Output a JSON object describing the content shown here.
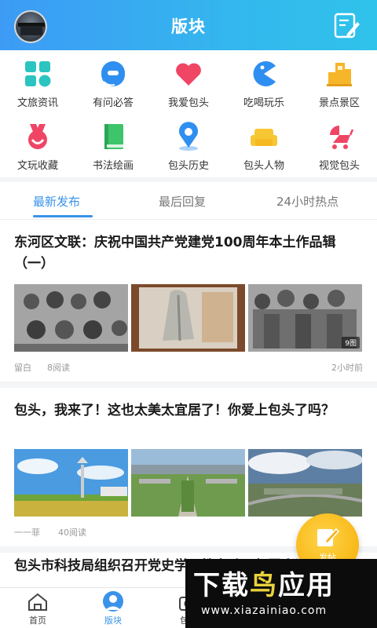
{
  "header": {
    "title": "版块"
  },
  "categories": [
    {
      "label": "文旅资讯",
      "icon": "grid-icon"
    },
    {
      "label": "有问必答",
      "icon": "headset-icon"
    },
    {
      "label": "我爱包头",
      "icon": "heart-icon"
    },
    {
      "label": "吃喝玩乐",
      "icon": "pacman-icon"
    },
    {
      "label": "景点景区",
      "icon": "building-icon"
    },
    {
      "label": "文玩收藏",
      "icon": "medal-icon"
    },
    {
      "label": "书法绘画",
      "icon": "book-icon"
    },
    {
      "label": "包头历史",
      "icon": "location-pin-icon"
    },
    {
      "label": "包头人物",
      "icon": "sofa-icon"
    },
    {
      "label": "视觉包头",
      "icon": "stroller-icon"
    }
  ],
  "tabs": [
    {
      "label": "最新发布",
      "active": true
    },
    {
      "label": "最后回复",
      "active": false
    },
    {
      "label": "24小时热点",
      "active": false
    }
  ],
  "posts": [
    {
      "title": "东河区文联：庆祝中国共产党建党100周年本土作品辑（一）",
      "author": "留白",
      "reads": "8阅读",
      "time": "2小时前",
      "image_count": "9图"
    },
    {
      "title": "包头，我来了！这也太美太宜居了！你爱上包头了吗？",
      "author": "一一菲",
      "reads": "40阅读"
    },
    {
      "title": "包头市科技局组织召开党史学习教育动员部署会议"
    }
  ],
  "fab": {
    "label": "发帖"
  },
  "bottom_nav": [
    {
      "label": "首页",
      "icon": "home-icon"
    },
    {
      "label": "版块",
      "icon": "forum-icon",
      "active": true
    },
    {
      "label": "包头",
      "icon": "camera-icon"
    }
  ],
  "watermark": {
    "brand_a": "下载",
    "brand_b": "鸟",
    "brand_c": "应用",
    "url": "www.xiazainiao.com"
  }
}
